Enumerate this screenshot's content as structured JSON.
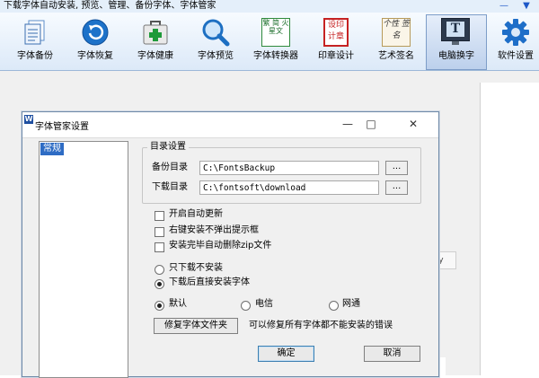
{
  "app": {
    "title": "下载字体自动安装, 预览、管理、备份字体、字体管家",
    "window_controls": [
      "—",
      "▼"
    ]
  },
  "toolbar": {
    "items": [
      {
        "label": "字体备份",
        "icon": "document-backup-icon"
      },
      {
        "label": "字体恢复",
        "icon": "restore-arrow-icon"
      },
      {
        "label": "字体健康",
        "icon": "first-aid-kit-icon"
      },
      {
        "label": "字体预览",
        "icon": "magnifier-icon"
      },
      {
        "label": "字体转换器",
        "icon": "font-converter-icon",
        "icon_text": "繁 简 火星文"
      },
      {
        "label": "印章设计",
        "icon": "seal-stamp-icon",
        "icon_text": "设印 计章"
      },
      {
        "label": "艺术签名",
        "icon": "art-signature-icon",
        "icon_text": "个性 签名"
      },
      {
        "label": "电脑换字",
        "icon": "monitor-font-icon",
        "icon_text": "T"
      },
      {
        "label": "软件设置",
        "icon": "gear-icon"
      }
    ],
    "active": "电脑换字"
  },
  "background": {
    "column_header": "My"
  },
  "dialog": {
    "title": "字体管家设置",
    "minimize": "—",
    "maximize": "□",
    "close": "✕",
    "tree": {
      "items": [
        "常规"
      ],
      "selected": "常规"
    },
    "directory_group": {
      "title": "目录设置",
      "backup_label": "备份目录",
      "backup_value": "C:\\FontsBackup",
      "download_label": "下载目录",
      "download_value": "C:\\fontsoft\\download",
      "browse_label": "..."
    },
    "checkboxes": [
      {
        "label": "开启自动更新",
        "checked": false
      },
      {
        "label": "右键安装不弹出提示框",
        "checked": false
      },
      {
        "label": "安装完毕自动删除zip文件",
        "checked": false
      }
    ],
    "mode_radios": [
      {
        "label": "只下载不安装",
        "checked": false
      },
      {
        "label": "下载后直接安装字体",
        "checked": true
      }
    ],
    "network_radios": [
      {
        "label": "默认",
        "checked": true
      },
      {
        "label": "电信",
        "checked": false
      },
      {
        "label": "网通",
        "checked": false
      }
    ],
    "repair_button": "修复字体文件夹",
    "repair_hint": "可以修复所有字体都不能安装的错误",
    "ok_button": "确定",
    "cancel_button": "取消"
  },
  "colors": {
    "selection": "#2e6cc4",
    "toolbar_top": "#f7fbff",
    "toolbar_bottom": "#dce9f8",
    "dialog_bg": "#f0f0f0"
  }
}
